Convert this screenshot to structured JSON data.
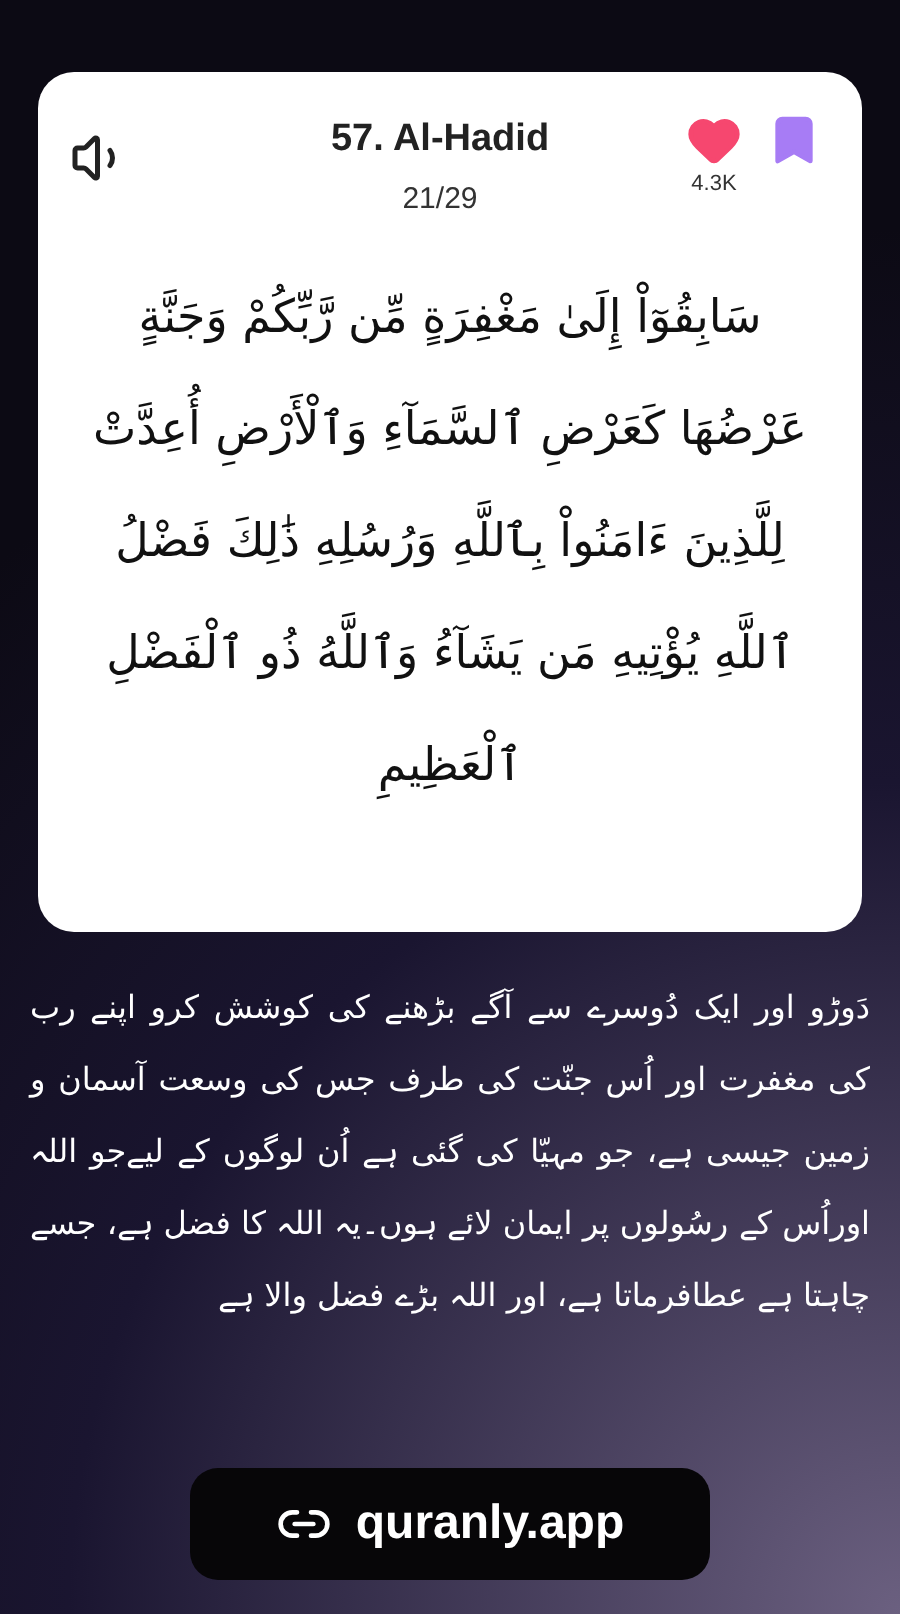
{
  "header": {
    "title": "57. Al-Hadid",
    "verse_position": "21/29",
    "likes": "4.3K",
    "liked": true,
    "bookmarked": true
  },
  "arabic_text": "سَابِقُوٓاْ إِلَىٰ مَغْفِرَةٍ مِّن رَّبِّكُمْ وَجَنَّةٍ عَرْضُهَا كَعَرْضِ ٱلسَّمَآءِ وَٱلْأَرْضِ أُعِدَّتْ لِلَّذِينَ ءَامَنُواْ بِٱللَّهِ وَرُسُلِهِ ذَٰلِكَ فَضْلُ ٱللَّهِ يُؤْتِيهِ مَن يَشَآءُ وَٱللَّهُ ذُو ٱلْفَضْلِ ٱلْعَظِيمِ",
  "translation": "دَوڑو اور ایک دُوسرے سے آگے بڑھنے کی کوشش کرو اپنے رب کی مغفرت اور اُس جنّت کی طرف جس کی وسعت آسمان و زمین جیسی ہے، جو مہیّا کی گئی ہے اُن لوگوں کے لیےجو اللہ اوراُس کے رسُولوں پر ایمان لائے ہوں۔یہ اللہ کا فضل ہے، جسے چاہتا ہے عطافرماتا ہے، اور اللہ بڑے فضل والا ہے",
  "link": "quranly.app"
}
